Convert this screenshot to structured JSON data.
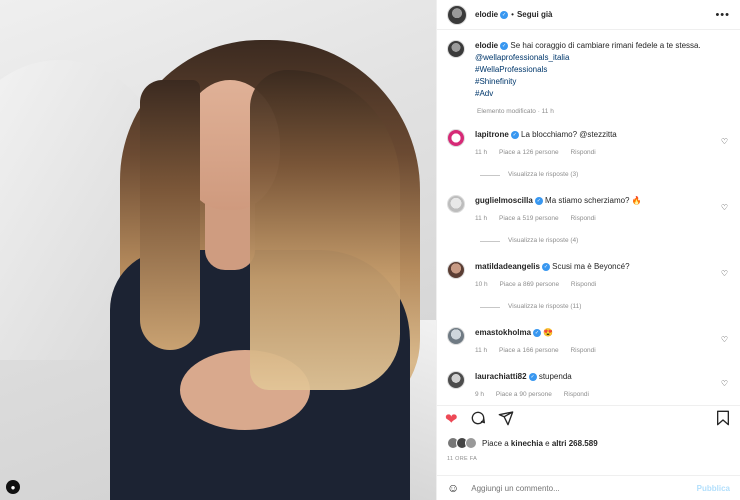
{
  "header": {
    "username": "elodie",
    "separator": "•",
    "follow_label": "Segui già",
    "more_label": "•••"
  },
  "caption": {
    "username": "elodie",
    "text": "Se hai coraggio di cambiare rimani fedele a te stessa.",
    "tags": [
      "@wellaprofessionals_italia",
      "#WellaProfessionals",
      "#Shinefinity",
      "#Adv"
    ],
    "meta": "Elemento modificato · 11 h"
  },
  "comments": [
    {
      "username": "lapitrone",
      "text": "La blocchiamo? @stezzitta",
      "time": "11 h",
      "likes": "Piace a 126 persone",
      "reply": "Rispondi",
      "view_replies": "Visualizza le risposte (3)"
    },
    {
      "username": "guglielmoscilla",
      "text": "Ma stiamo scherziamo? 🔥",
      "time": "11 h",
      "likes": "Piace a 519 persone",
      "reply": "Rispondi",
      "view_replies": "Visualizza le risposte (4)"
    },
    {
      "username": "matildadeangelis",
      "text": "Scusi ma è Beyoncé?",
      "time": "10 h",
      "likes": "Piace a 869 persone",
      "reply": "Rispondi",
      "view_replies": "Visualizza le risposte (11)"
    },
    {
      "username": "emastokholma",
      "text": "😍",
      "time": "11 h",
      "likes": "Piace a 166 persone",
      "reply": "Rispondi",
      "view_replies": ""
    },
    {
      "username": "laurachiatti82",
      "text": "stupenda",
      "time": "9 h",
      "likes": "Piace a 90 persone",
      "reply": "Rispondi",
      "view_replies": ""
    }
  ],
  "likes": {
    "prefix": "Piace a ",
    "user": "kinechia",
    "middle": " e ",
    "others": "altri 268.589"
  },
  "date": "11 ORE FA",
  "add_comment": {
    "placeholder": "Aggiungi un commento...",
    "publish_label": "Pubblica"
  },
  "colors": {
    "like_red": "#ed4956",
    "link_blue": "#00376b",
    "verified_blue": "#3897f0",
    "publish_disabled": "#b2dffc"
  },
  "icons": [
    "heart-icon",
    "comment-icon",
    "share-icon",
    "bookmark-icon",
    "emoji-icon",
    "more-icon",
    "verified-icon"
  ]
}
